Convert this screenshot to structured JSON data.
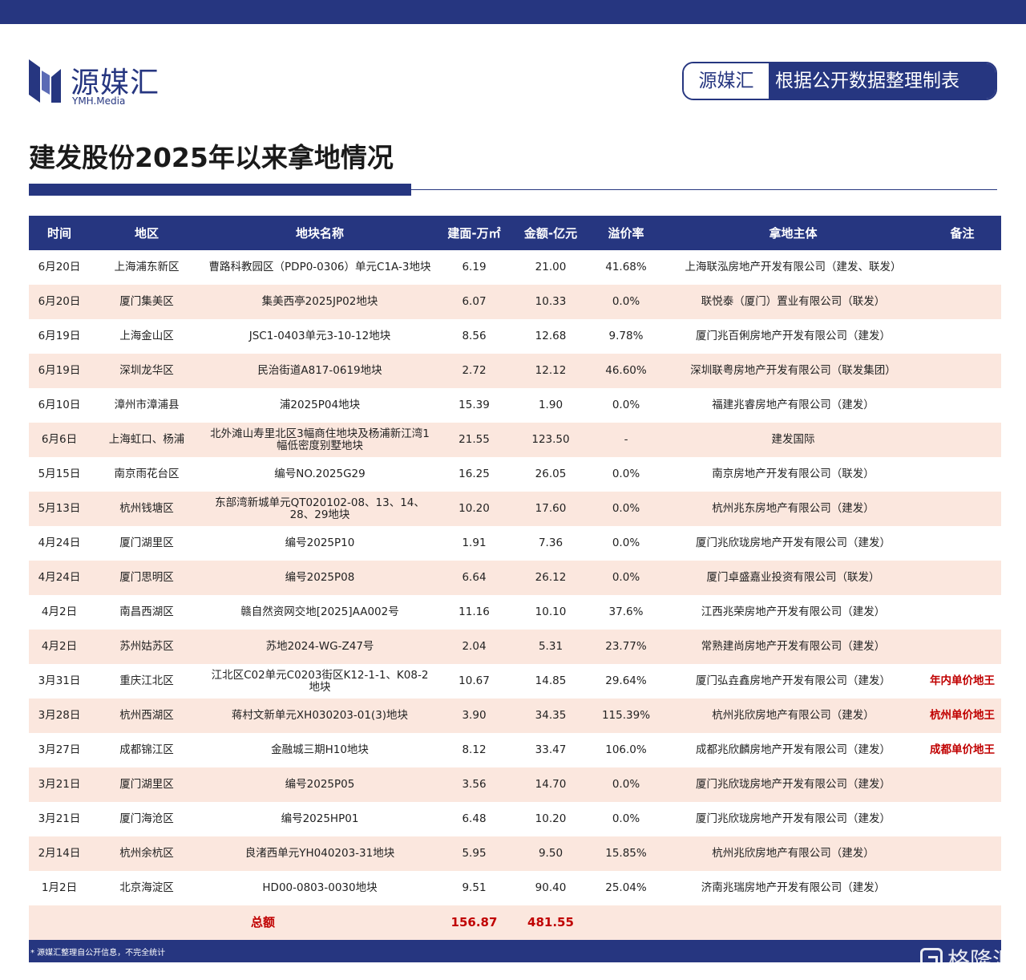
{
  "header": {
    "logo_cn": "源媒汇",
    "logo_en": "YMH.Media",
    "badge_left": "源媒汇",
    "badge_right": "根据公开数据整理制表",
    "colors": {
      "brand": "#263680",
      "row_alt": "#fbe7de",
      "remark": "#c00000"
    }
  },
  "title": "建发股份2025年以来拿地情况",
  "table": {
    "columns": [
      "时间",
      "地区",
      "地块名称",
      "建面-万㎡",
      "金额-亿元",
      "溢价率",
      "拿地主体",
      "备注"
    ],
    "rows": [
      [
        "6月20日",
        "上海浦东新区",
        "曹路科教园区（PDP0-0306）单元C1A-3地块",
        "6.19",
        "21.00",
        "41.68%",
        "上海联泓房地产开发有限公司（建发、联发）",
        ""
      ],
      [
        "6月20日",
        "厦门集美区",
        "集美西亭2025JP02地块",
        "6.07",
        "10.33",
        "0.0%",
        "联悦泰（厦门）置业有限公司（联发）",
        ""
      ],
      [
        "6月19日",
        "上海金山区",
        "JSC1-0403单元3-10-12地块",
        "8.56",
        "12.68",
        "9.78%",
        "厦门兆百俐房地产开发有限公司（建发）",
        ""
      ],
      [
        "6月19日",
        "深圳龙华区",
        "民治街道A817-0619地块",
        "2.72",
        "12.12",
        "46.60%",
        "深圳联粤房地产开发有限公司（联发集团）",
        ""
      ],
      [
        "6月10日",
        "漳州市漳浦县",
        "浦2025P04地块",
        "15.39",
        "1.90",
        "0.0%",
        "福建兆睿房地产有限公司（建发）",
        ""
      ],
      [
        "6月6日",
        "上海虹口、杨浦",
        "北外滩山寿里北区3幅商住地块及杨浦新江湾1幅低密度别墅地块",
        "21.55",
        "123.50",
        "-",
        "建发国际",
        ""
      ],
      [
        "5月15日",
        "南京雨花台区",
        "编号NO.2025G29",
        "16.25",
        "26.05",
        "0.0%",
        "南京房地产开发有限公司（联发）",
        ""
      ],
      [
        "5月13日",
        "杭州钱塘区",
        "东部湾新城单元QT020102-08、13、14、28、29地块",
        "10.20",
        "17.60",
        "0.0%",
        "杭州兆东房地产有限公司（建发）",
        ""
      ],
      [
        "4月24日",
        "厦门湖里区",
        "编号2025P10",
        "1.91",
        "7.36",
        "0.0%",
        "厦门兆欣珑房地产开发有限公司（建发）",
        ""
      ],
      [
        "4月24日",
        "厦门思明区",
        "编号2025P08",
        "6.64",
        "26.12",
        "0.0%",
        "厦门卓盛嘉业投资有限公司（联发）",
        ""
      ],
      [
        "4月2日",
        "南昌西湖区",
        "赣自然资网交地[2025]AA002号",
        "11.16",
        "10.10",
        "37.6%",
        "江西兆荣房地产开发有限公司（建发）",
        ""
      ],
      [
        "4月2日",
        "苏州姑苏区",
        "苏地2024-WG-Z47号",
        "2.04",
        "5.31",
        "23.77%",
        "常熟建尚房地产开发有限公司（建发）",
        ""
      ],
      [
        "3月31日",
        "重庆江北区",
        "江北区C02单元C0203街区K12-1-1、K08-2地块",
        "10.67",
        "14.85",
        "29.64%",
        "厦门弘垚鑫房地产开发有限公司（建发）",
        "年内单价地王"
      ],
      [
        "3月28日",
        "杭州西湖区",
        "蒋村文新单元XH030203-01(3)地块",
        "3.90",
        "34.35",
        "115.39%",
        "杭州兆欣房地产有限公司（建发）",
        "杭州单价地王"
      ],
      [
        "3月27日",
        "成都锦江区",
        "金融城三期H10地块",
        "8.12",
        "33.47",
        "106.0%",
        "成都兆欣麟房地产开发有限公司（建发）",
        "成都单价地王"
      ],
      [
        "3月21日",
        "厦门湖里区",
        "编号2025P05",
        "3.56",
        "14.70",
        "0.0%",
        "厦门兆欣珑房地产开发有限公司（建发）",
        ""
      ],
      [
        "3月21日",
        "厦门海沧区",
        "编号2025HP01",
        "6.48",
        "10.20",
        "0.0%",
        "厦门兆欣珑房地产开发有限公司（建发）",
        ""
      ],
      [
        "2月14日",
        "杭州余杭区",
        "良渚西单元YH040203-31地块",
        "5.95",
        "9.50",
        "15.85%",
        "杭州兆欣房地产有限公司（建发）",
        ""
      ],
      [
        "1月2日",
        "北京海淀区",
        "HD00-0803-0030地块",
        "9.51",
        "90.40",
        "25.04%",
        "济南兆瑞房地产开发有限公司（建发）",
        ""
      ]
    ],
    "total": {
      "label": "总额",
      "area": "156.87",
      "amount": "481.55"
    }
  },
  "footer": {
    "note": "* 源媒汇整理自公开信息，不完全统计",
    "watermark": "格隆汇"
  }
}
